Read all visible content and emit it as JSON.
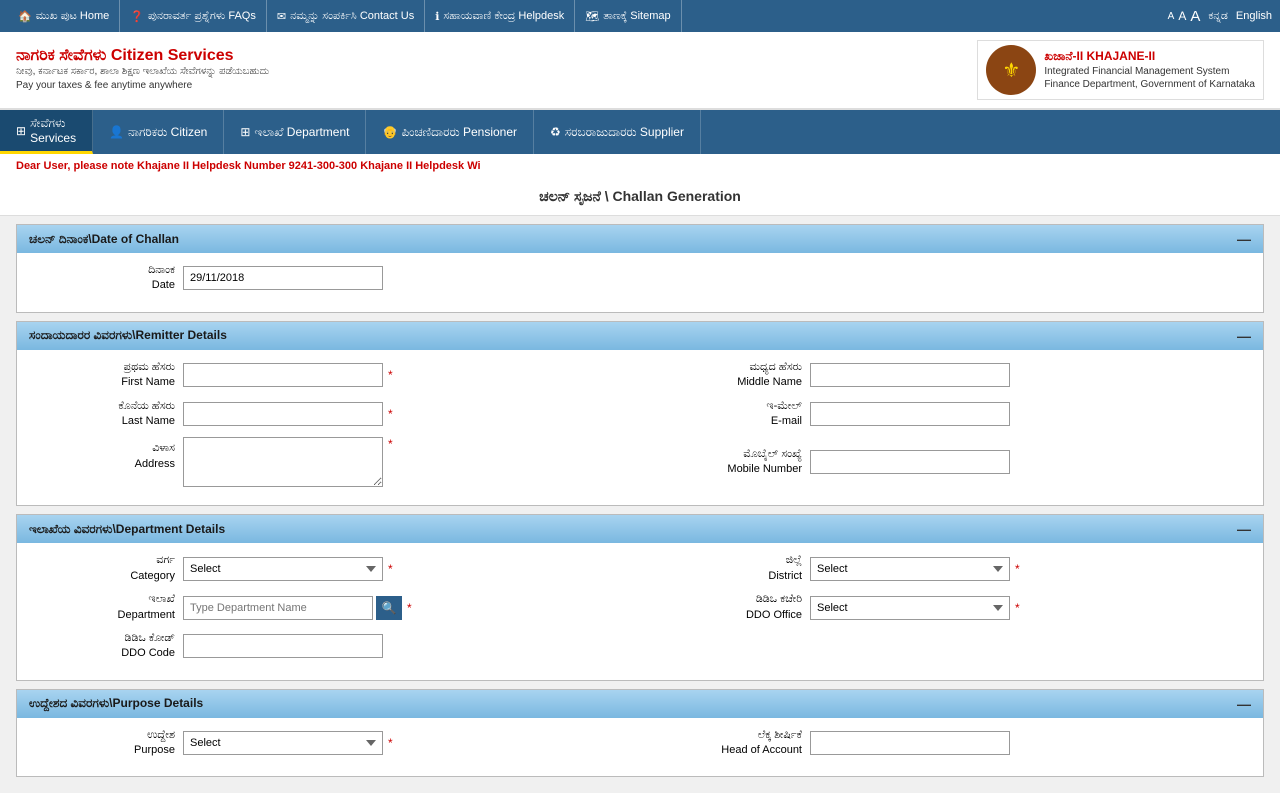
{
  "topNav": {
    "items": [
      {
        "label": "ಮುಖ ಪುಟ Home",
        "icon": "home-icon"
      },
      {
        "label": "ಪುನರಾವರ್ತ ಪ್ರಶ್ನೆಗಳು FAQs",
        "icon": "question-icon"
      },
      {
        "label": "ನಮ್ಮನ್ನು ಸಂಪರ್ಕಿಸಿ Contact Us",
        "icon": "email-icon"
      },
      {
        "label": "ಸಹಾಯವಾಣಿ ಕೇಂದ್ರ Helpdesk",
        "icon": "help-icon"
      },
      {
        "label": "ತಾಣಕ್ಕೆ Sitemap",
        "icon": "sitemap-icon"
      }
    ],
    "fontSizes": [
      "A",
      "A",
      "A"
    ],
    "languages": [
      "ಕನ್ನಡ",
      "English"
    ]
  },
  "header": {
    "siteTitle": "ನಾಗರಿಕ ಸೇವೆಗಳು Citizen Services",
    "subtitle1": "ನೀವು, ಕರ್ನಾಟಕ ಸರ್ಕಾರ, ಶಾಲಾ ಶಿಕ್ಷಣ ಇಲಾಖೆಯ ಸೇವೆಗಳನ್ನು ಪಡೆಯಬಹುದು",
    "subtitle2": "Pay your taxes & fee anytime anywhere",
    "logoTitle": "ಖಜಾನೆ-II KHAJANE-II",
    "logoSubtitle": "Integrated Financial Management System",
    "logoSubtitle2": "Finance Department, Government of Karnataka"
  },
  "mainNav": {
    "items": [
      {
        "label": "ಸೇವೆಗಳು\nServices",
        "icon": "services-icon",
        "active": true
      },
      {
        "label": "ನಾಗರಿಕರು Citizen",
        "icon": "citizen-icon"
      },
      {
        "label": "ಇಲಾಖೆ Department",
        "icon": "dept-icon"
      },
      {
        "label": "ಪಿಂಚಣಿದಾರರು Pensioner",
        "icon": "pensioner-icon"
      },
      {
        "label": "ಸರಬರಾಜುದಾರರು Supplier",
        "icon": "supplier-icon"
      }
    ]
  },
  "notice": {
    "text": "Dear User, please note Khajane II Helpdesk Number 9241-300-300 Khajane II Helpdesk Wi"
  },
  "pageTitle": {
    "kannada": "ಚಲನ್ ಸೃಜನೆ",
    "english": "Challan Generation",
    "separator": "\\"
  },
  "sections": {
    "challanDate": {
      "title": "ಚಲನ್ ದಿನಾಂಕ\\Date of Challan",
      "dateLabel": "ದಿನಾಂಕ\nDate",
      "dateValue": "29/11/2018"
    },
    "remitter": {
      "title": "ಸಂದಾಯದಾರರ ವಿವರಗಳು\\Remitter Details",
      "fields": {
        "firstName": {
          "kannada": "ಪ್ರಥಮ ಹೆಸರು",
          "english": "First Name"
        },
        "middleName": {
          "kannada": "ಮಧ್ಯದ ಹೆಸರು",
          "english": "Middle Name"
        },
        "lastName": {
          "kannada": "ಕೊನೆಯ ಹೆಸರು",
          "english": "Last Name"
        },
        "email": {
          "kannada": "ಇ-ಮೇಲ್",
          "english": "E-mail"
        },
        "address": {
          "kannada": "ವಿಳಾಸ",
          "english": "Address"
        },
        "mobile": {
          "kannada": "ಮೊಬೈಲ್ ಸಂಖ್ಯೆ",
          "english": "Mobile Number"
        }
      }
    },
    "department": {
      "title": "ಇಲಾಖೆಯ ವಿವರಗಳು\\Department Details",
      "fields": {
        "category": {
          "kannada": "ವರ್ಗ",
          "english": "Category"
        },
        "district": {
          "kannada": "ಜಿಲ್ಲೆ",
          "english": "District"
        },
        "department": {
          "kannada": "ಇಲಾಖೆ",
          "english": "Department"
        },
        "ddoOffice": {
          "kannada": "ಡಿಡಿಒ ಕಚೇರಿ",
          "english": "DDO Office"
        },
        "ddoCode": {
          "kannada": "ಡಿಡಿಒ ಕೋಡ್",
          "english": "DDO Code"
        }
      },
      "categoryPlaceholder": "Select",
      "districtPlaceholder": "Select",
      "ddoOfficePlaceholder": "Select",
      "deptPlaceholder": "Type Department Name"
    },
    "purpose": {
      "title": "ಉದ್ದೇಶದ ವಿವರಗಳು\\Purpose Details",
      "fields": {
        "purpose": {
          "kannada": "ಉದ್ದೇಶ",
          "english": "Purpose"
        },
        "headOfAccount": {
          "kannada": "ಲೆಕ್ಕ ಶೀರ್ಷಿಕೆ",
          "english": "Head of Account"
        }
      },
      "purposePlaceholder": "Select"
    }
  }
}
